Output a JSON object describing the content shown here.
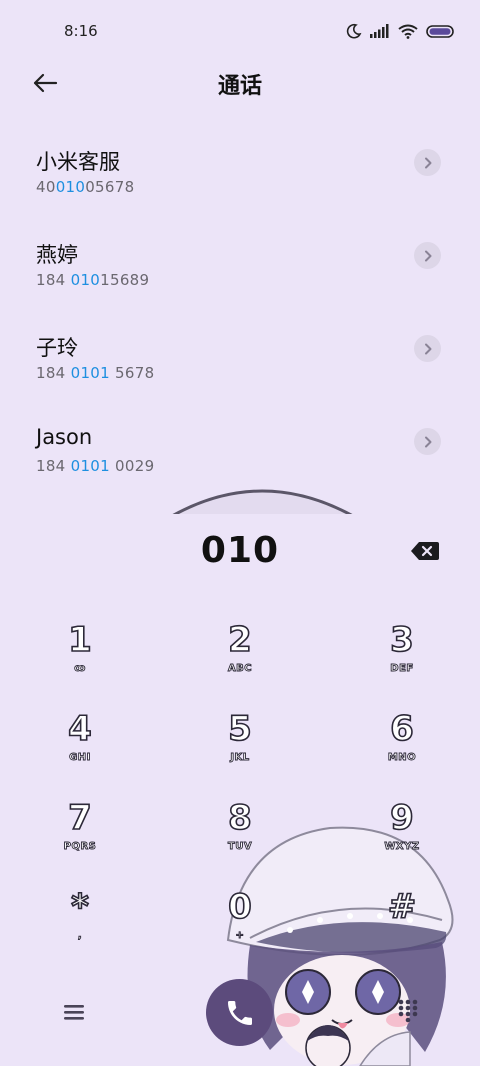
{
  "status": {
    "time": "8:16"
  },
  "header": {
    "title": "通话"
  },
  "contacts": [
    {
      "name": "小米客服",
      "number_pre": "40",
      "number_hl": "010",
      "number_post": "05678"
    },
    {
      "name": "燕婷",
      "number_pre": "184 ",
      "number_hl": "010",
      "number_post": "15689"
    },
    {
      "name": "子玲",
      "number_pre": "184 ",
      "number_hl": "0101",
      "number_post": " 5678"
    },
    {
      "name": "Jason",
      "number_pre": "184 ",
      "number_hl": "0101",
      "number_post": " 0029"
    }
  ],
  "dialer": {
    "entered": "010"
  },
  "keys": [
    {
      "digit": "1",
      "sub": "ꝏ"
    },
    {
      "digit": "2",
      "sub": "ABC"
    },
    {
      "digit": "3",
      "sub": "DEF"
    },
    {
      "digit": "4",
      "sub": "GHI"
    },
    {
      "digit": "5",
      "sub": "JKL"
    },
    {
      "digit": "6",
      "sub": "MNO"
    },
    {
      "digit": "7",
      "sub": "PQRS"
    },
    {
      "digit": "8",
      "sub": "TUV"
    },
    {
      "digit": "9",
      "sub": "WXYZ"
    },
    {
      "digit": "*",
      "sub": ","
    },
    {
      "digit": "0",
      "sub": "+"
    },
    {
      "digit": "#",
      "sub": ""
    }
  ],
  "colors": {
    "background": "#ece4f8",
    "highlight": "#1e8fe0",
    "call_button": "#5c4b7c"
  },
  "icons": {
    "status": [
      "moon-icon",
      "signal-icon",
      "wifi-icon",
      "battery-icon"
    ],
    "back": "arrow-left-icon",
    "backspace": "backspace-icon",
    "menu": "menu-icon",
    "call": "phone-icon",
    "dialpad": "dialpad-icon"
  }
}
